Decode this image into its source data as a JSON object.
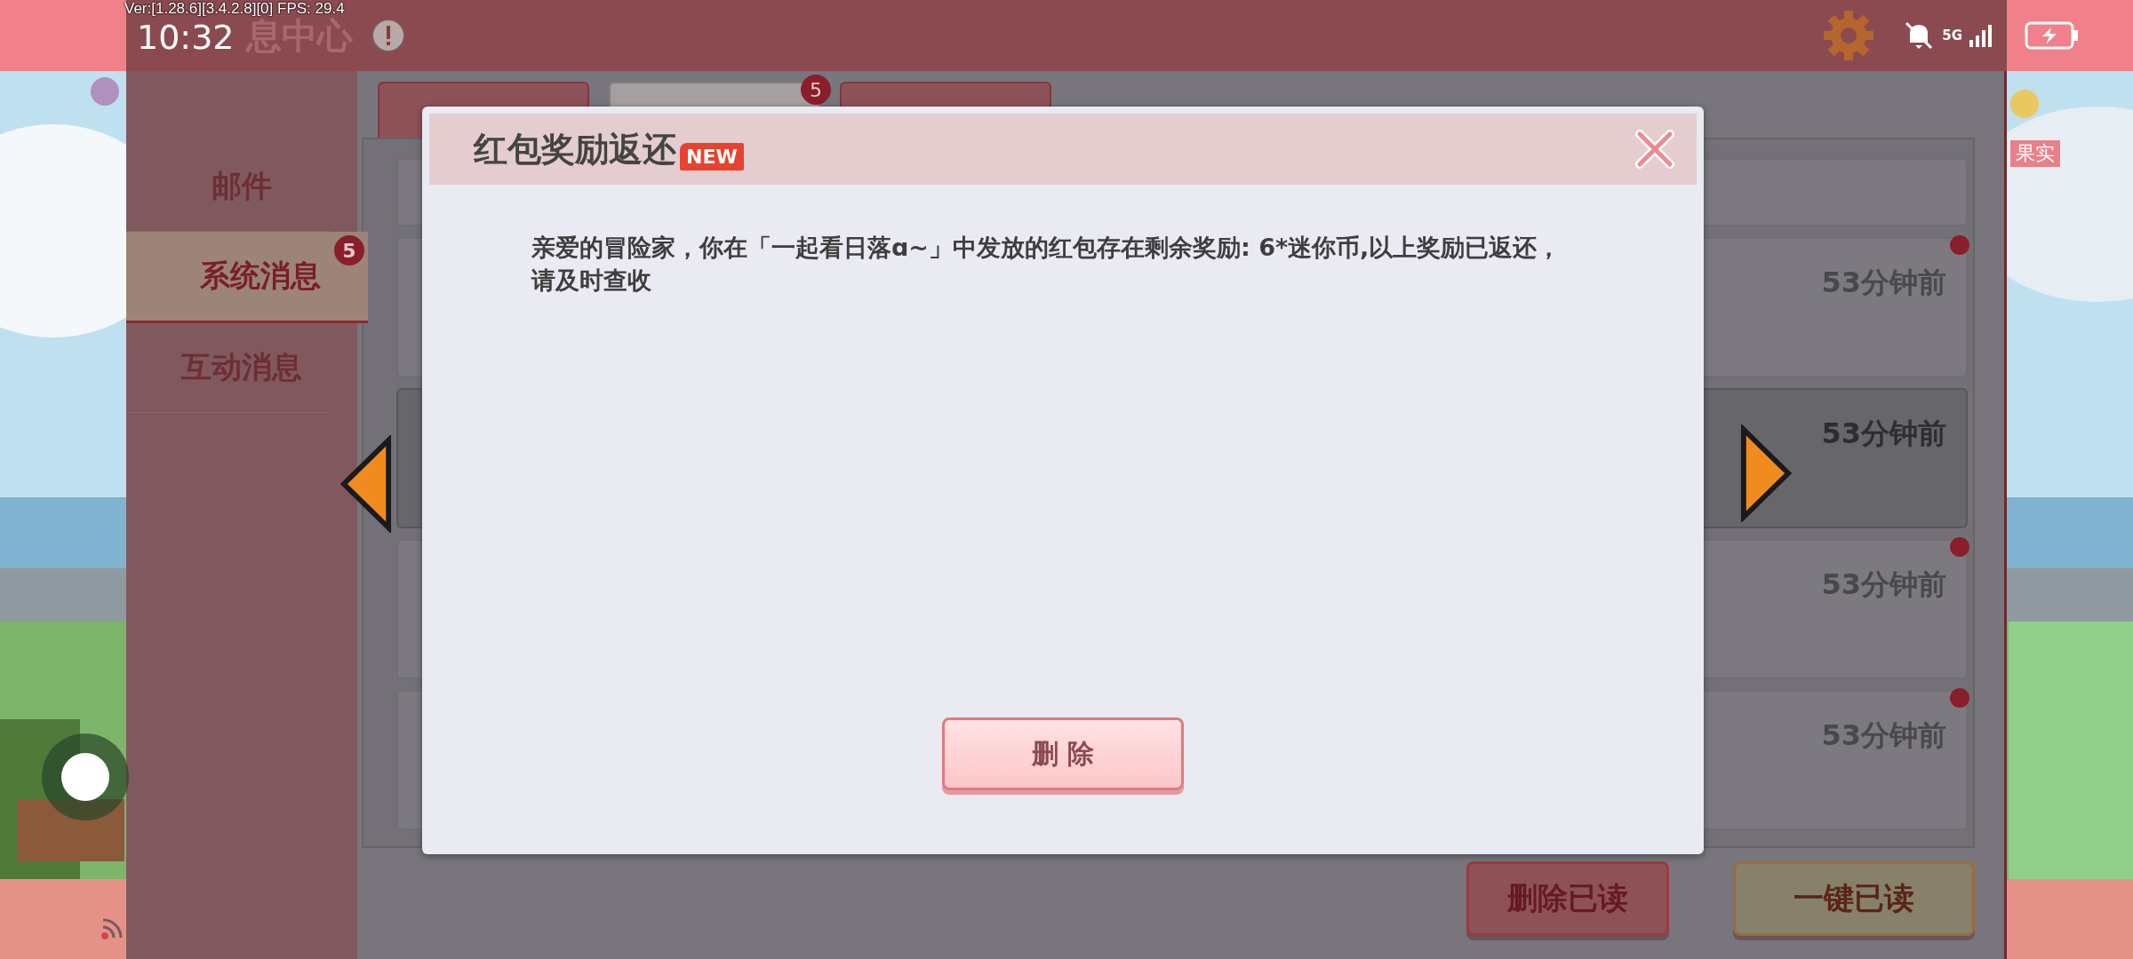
{
  "status_bar": {
    "version": "Ver:[1.28.6][3.4.2.8][0] FPS: 29.4",
    "time": "10:32",
    "network": "5G"
  },
  "header": {
    "title": "息中心"
  },
  "side_label": "果实",
  "tabs": [
    {
      "selected": false
    },
    {
      "selected": true,
      "badge": "5"
    },
    {
      "selected": false
    }
  ],
  "sidebar": {
    "items": [
      {
        "label": "邮件",
        "selected": false
      },
      {
        "label": "系统消息",
        "selected": true,
        "badge": "5"
      },
      {
        "label": "互动消息",
        "selected": false
      }
    ]
  },
  "messages": [
    {
      "unread": false,
      "selected": false
    },
    {
      "time": "53分钟前",
      "unread": true,
      "selected": false
    },
    {
      "time": "53分钟前",
      "unread": false,
      "selected": true
    },
    {
      "time": "53分钟前",
      "unread": true,
      "selected": false
    },
    {
      "time": "53分钟前",
      "unread": true,
      "selected": false
    }
  ],
  "actions": [
    {
      "label": "删除已读",
      "kind": "danger"
    },
    {
      "label": "一键已读",
      "kind": "confirm"
    }
  ],
  "dialog": {
    "title": "红包奖励返还",
    "badge": "NEW",
    "body": "亲爱的冒险家，你在「一起看日落ɑ~」中发放的红包存在剩余奖励: 6*迷你币,以上奖励已返还，请及时查收",
    "button": "删 除"
  }
}
